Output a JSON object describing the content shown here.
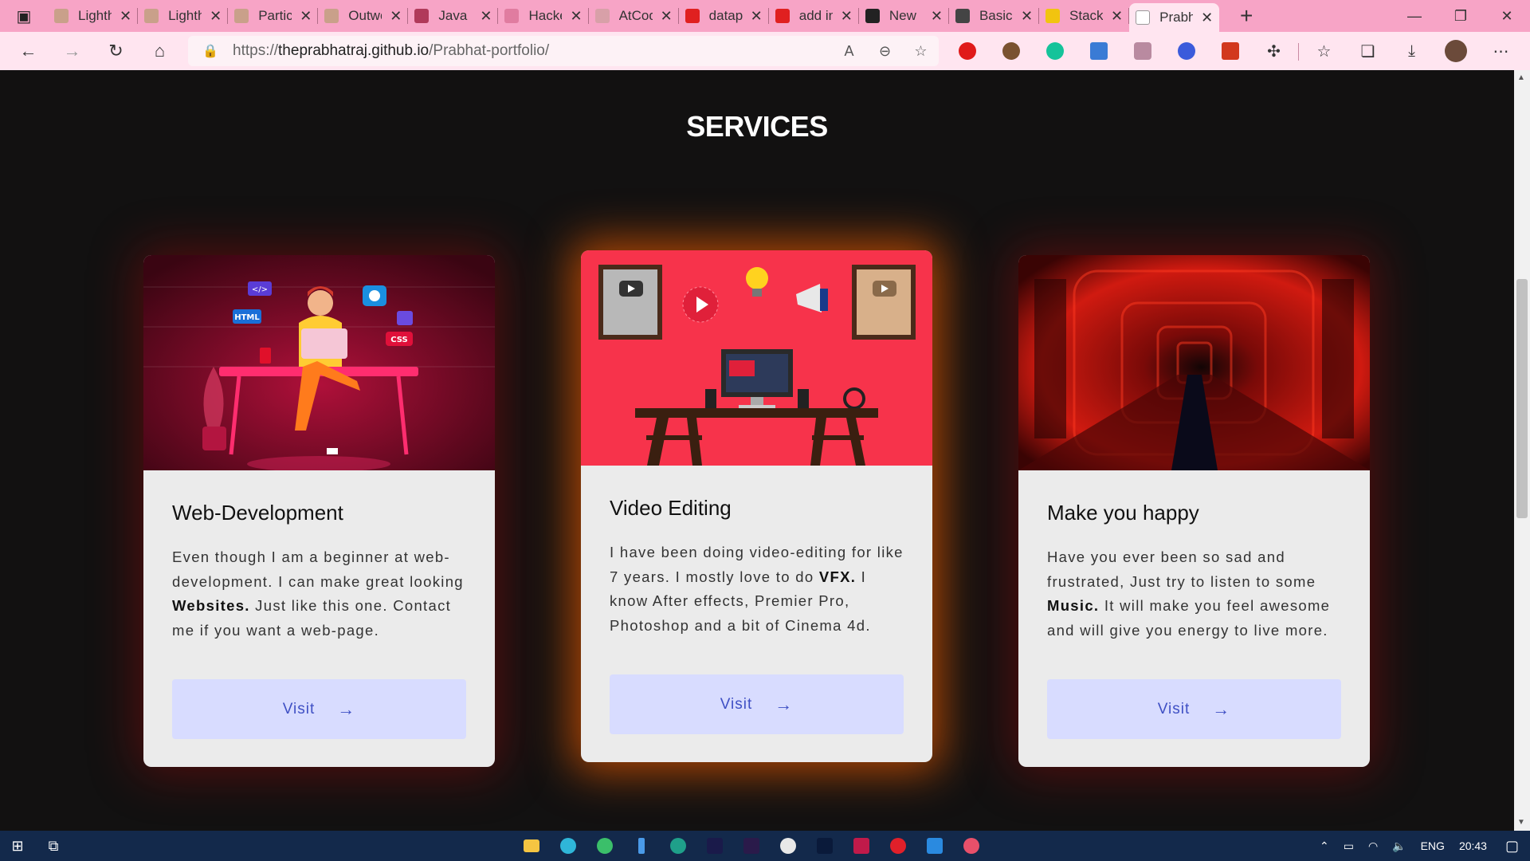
{
  "tabs": [
    {
      "title": "Lighthouse",
      "color": "#c9a08a"
    },
    {
      "title": "Lighthouse",
      "color": "#c9a08a"
    },
    {
      "title": "Particles",
      "color": "#c9a08a"
    },
    {
      "title": "Outworld",
      "color": "#c9a08a"
    },
    {
      "title": "Java Basics",
      "color": "#b03a5a"
    },
    {
      "title": "Hackerrank",
      "color": "#e07ca0"
    },
    {
      "title": "AtCoder",
      "color": "#d8a0a8"
    },
    {
      "title": "datapack",
      "color": "#e02020"
    },
    {
      "title": "add in",
      "color": "#e02020"
    },
    {
      "title": "New",
      "color": "#222222"
    },
    {
      "title": "Basic",
      "color": "#444444"
    },
    {
      "title": "Stack",
      "color": "#f1c40f"
    },
    {
      "title": "Prabhat",
      "color": "#ffffff",
      "active": true
    }
  ],
  "url": {
    "prefix": "https://",
    "host": "theprabhatraj.github.io",
    "path": "/Prabhat-portfolio/"
  },
  "section_title": "SERVICES",
  "cards": [
    {
      "title": "Web-Development",
      "text_before": "Even though I am a beginner at web-development. I can make great looking ",
      "bold": "Websites.",
      "text_after": " Just like this one. Contact me if you want a web-page.",
      "button": "Visit",
      "arrow": "→"
    },
    {
      "title": "Video Editing",
      "text_before": "I have been doing video-editing for like 7 years. I mostly love to do ",
      "bold": "VFX.",
      "text_after": " I know After effects, Premier Pro, Photoshop and a bit of Cinema 4d.",
      "button": "Visit",
      "arrow": "→"
    },
    {
      "title": "Make you happy",
      "text_before": "Have you ever been so sad and frustrated, Just try to listen to some ",
      "bold": "Music.",
      "text_after": " It will make you feel awesome and will give you energy to live more.",
      "button": "Visit",
      "arrow": "→"
    }
  ],
  "illustration_labels": {
    "html": "HTML",
    "css": "CSS",
    "code": "</>"
  },
  "taskbar": {
    "language": "ENG",
    "time": "20:43"
  },
  "colors": {
    "tabbar": "#f7a4c6",
    "toolbar": "#ffe5f0",
    "page_bg": "#121111",
    "card_bg": "#ebebeb",
    "button_bg": "#d8dcff",
    "button_text": "#3e4fc4"
  }
}
